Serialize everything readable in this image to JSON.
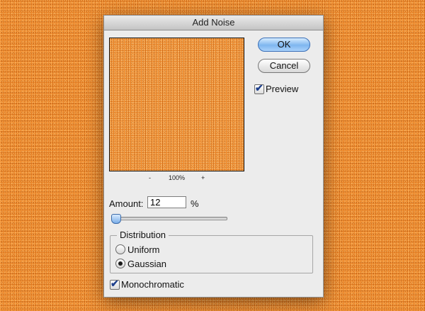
{
  "dialog": {
    "title": "Add Noise",
    "zoom": {
      "minus": "-",
      "level": "100%",
      "plus": "+"
    },
    "buttons": {
      "ok": "OK",
      "cancel": "Cancel"
    },
    "preview": {
      "label": "Preview",
      "checked": true
    },
    "amount": {
      "label": "Amount:",
      "value": "12",
      "unit": "%",
      "slider_fraction": 0.03
    },
    "distribution": {
      "legend": "Distribution",
      "options": [
        {
          "label": "Uniform",
          "selected": false
        },
        {
          "label": "Gaussian",
          "selected": true
        }
      ]
    },
    "monochromatic": {
      "label": "Monochromatic",
      "checked": true
    }
  },
  "colors": {
    "background_orange": "#f08a2c",
    "ok_blue": "#7fb6ef",
    "check_blue": "#1d3f8c"
  },
  "icons": {
    "check": "checkmark-icon",
    "radio": "radio-dot-icon"
  }
}
